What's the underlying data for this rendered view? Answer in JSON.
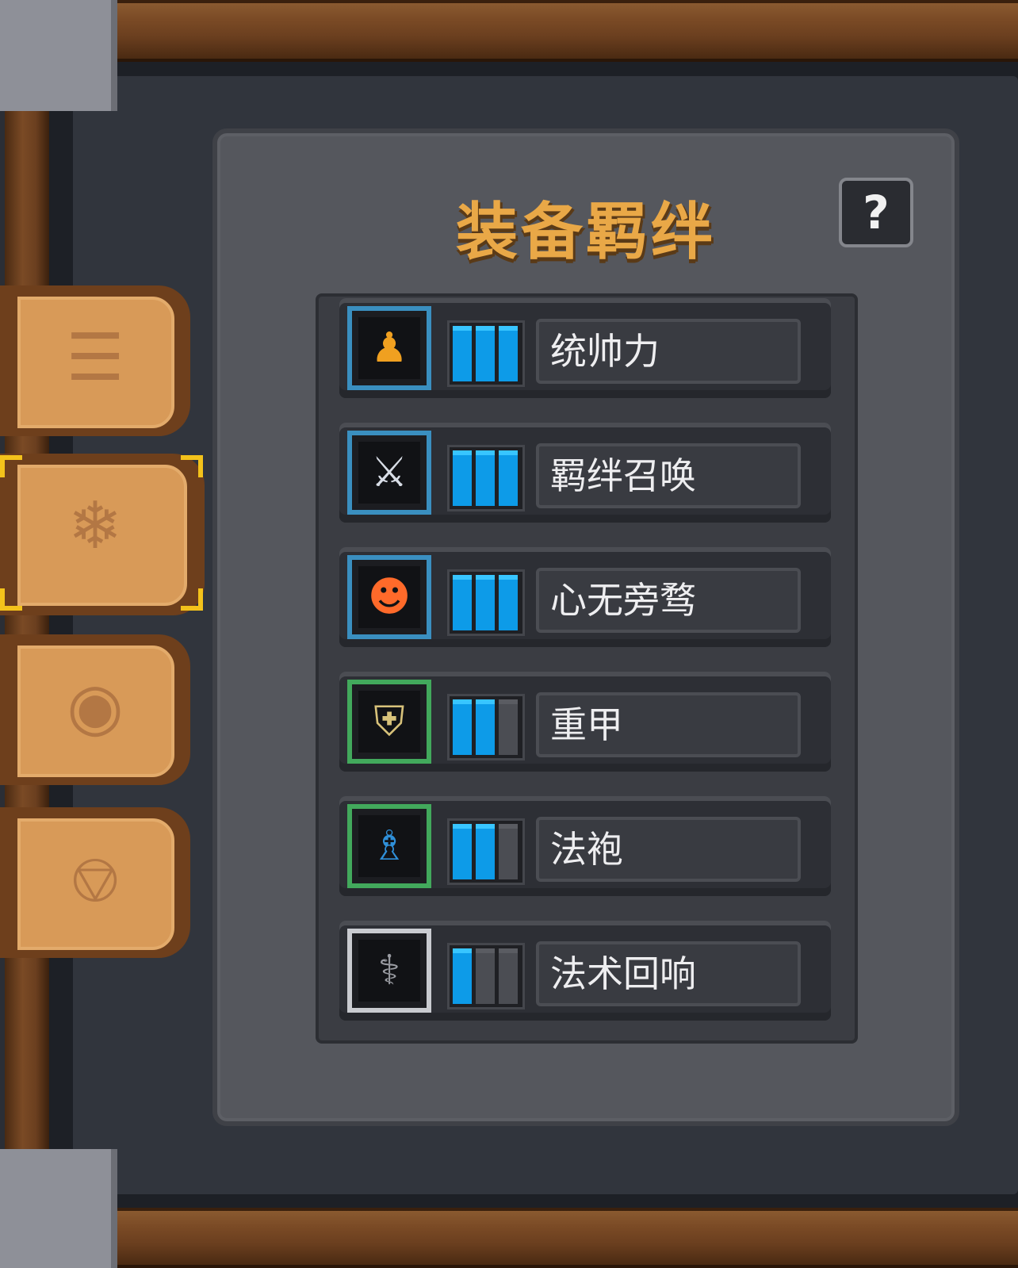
{
  "panel": {
    "title": "装备羁绊",
    "help_label": "?"
  },
  "side_tabs": [
    {
      "name": "codex",
      "icon": "book-icon",
      "active": false
    },
    {
      "name": "equipment-bond",
      "icon": "magic-box-icon",
      "active": true
    },
    {
      "name": "paw",
      "icon": "paw-icon",
      "active": false
    },
    {
      "name": "gear",
      "icon": "bell-icon",
      "active": false
    }
  ],
  "bonds": [
    {
      "label": "统帅力",
      "icon": "chess-pawn-icon",
      "rarity": "blue",
      "level": 3,
      "max": 3
    },
    {
      "label": "羁绊召唤",
      "icon": "star-sword-icon",
      "rarity": "blue",
      "level": 3,
      "max": 3
    },
    {
      "label": "心无旁骛",
      "icon": "flame-figure-icon",
      "rarity": "blue",
      "level": 3,
      "max": 3
    },
    {
      "label": "重甲",
      "icon": "heavy-armor-icon",
      "rarity": "green",
      "level": 2,
      "max": 3
    },
    {
      "label": "法袍",
      "icon": "robe-icon",
      "rarity": "green",
      "level": 2,
      "max": 3
    },
    {
      "label": "法术回响",
      "icon": "echo-cane-icon",
      "rarity": "white",
      "level": 1,
      "max": 3
    }
  ],
  "colors": {
    "title": "#e9a847",
    "pip_on": "#0d9be8",
    "rarity_blue": "#3a8fc0",
    "rarity_green": "#42a95c",
    "rarity_white": "#c9cbd0",
    "selection": "#f3c21b"
  }
}
